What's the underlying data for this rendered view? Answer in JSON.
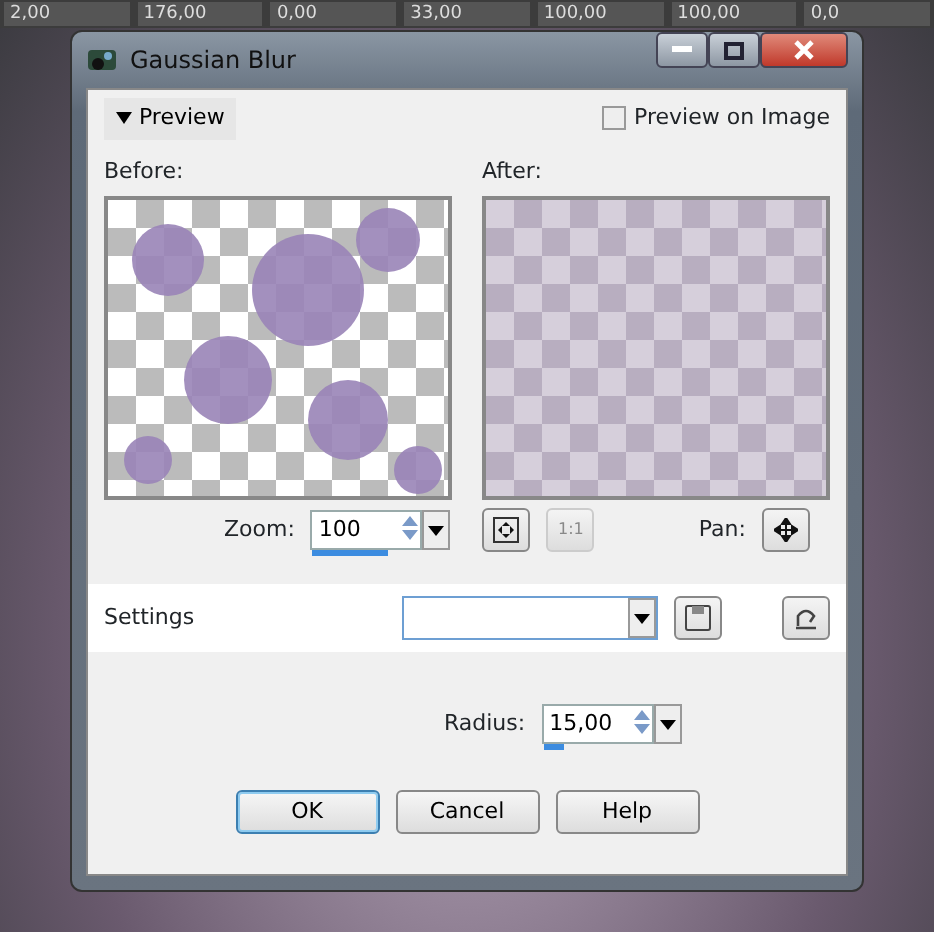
{
  "toolbar": {
    "values": [
      "2,00",
      "176,00",
      "0,00",
      "33,00",
      "100,00",
      "100,00",
      "0,0"
    ]
  },
  "window": {
    "title": "Gaussian Blur"
  },
  "preview_bar": {
    "toggle": {
      "label": "Preview",
      "expanded": true
    },
    "preview_on_image": {
      "label": "Preview on Image",
      "checked": false
    }
  },
  "previews": [
    {
      "label": "Before:",
      "kind": "before"
    },
    {
      "label": "After:",
      "kind": "after"
    }
  ],
  "zoom": {
    "label": "Zoom:",
    "value": "100",
    "level": 0.7,
    "actual_size": {
      "label": "1:1",
      "disabled": true
    },
    "pan_label": "Pan:"
  },
  "settings": {
    "label": "Settings"
  },
  "radius": {
    "label": "Radius:",
    "value": "15,00",
    "level": 0.2
  },
  "buttons": [
    {
      "label": "OK",
      "default": true
    },
    {
      "label": "Cancel",
      "default": false
    },
    {
      "label": "Help",
      "default": false
    }
  ]
}
